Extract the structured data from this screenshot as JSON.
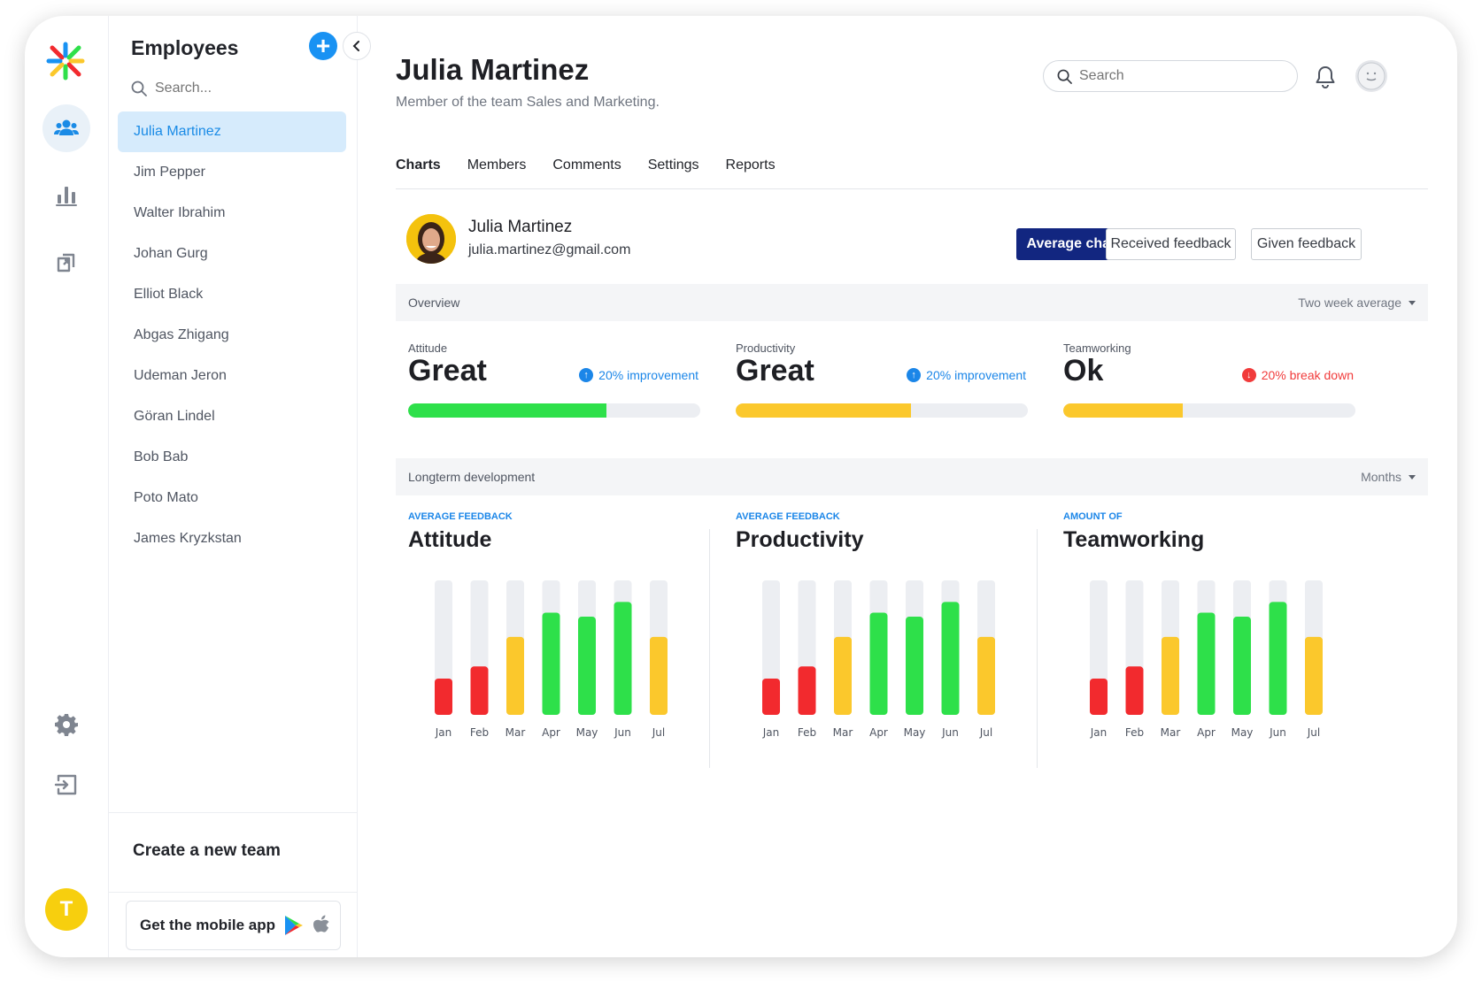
{
  "colors": {
    "accent": "#1992f3",
    "primary_button": "#122680",
    "green": "#2ee04a",
    "yellow": "#fbc82c",
    "red": "#f22a2e",
    "track": "#eceef2",
    "improvement": "#1b86e8",
    "breakdown": "#f13b3b"
  },
  "rail": {
    "items": [
      {
        "icon": "team-icon",
        "active": true
      },
      {
        "icon": "bar-chart-icon",
        "active": false
      },
      {
        "icon": "copy-icon",
        "active": false
      }
    ],
    "settings_icon": "gear-icon",
    "logout_icon": "logout-icon",
    "user_initial": "T"
  },
  "sidebar": {
    "title": "Employees",
    "search_placeholder": "Search...",
    "employees": [
      "Julia Martinez",
      "Jim Pepper",
      "Walter Ibrahim",
      "Johan Gurg",
      "Elliot Black",
      "Abgas Zhigang",
      "Udeman Jeron",
      "Göran Lindel",
      "Bob Bab",
      "Poto Mato",
      "James Kryzkstan"
    ],
    "active_index": 0,
    "create_team": "Create a new team",
    "mobile_app": "Get the mobile app"
  },
  "header": {
    "name": "Julia Martinez",
    "subtitle": "Member of the team Sales and Marketing.",
    "search_placeholder": "Search"
  },
  "tabs": [
    "Charts",
    "Members",
    "Comments",
    "Settings",
    "Reports"
  ],
  "profile": {
    "name": "Julia Martinez",
    "email": "julia.martinez@gmail.com"
  },
  "buttons": {
    "average": "Average charts",
    "received": "Received feedback",
    "given": "Given feedback"
  },
  "overview": {
    "label": "Overview",
    "range": "Two week average",
    "metrics": [
      {
        "label": "Attitude",
        "value": "Great",
        "delta": "20% improvement",
        "direction": "up",
        "level": 0.68,
        "color": "#2ee04a"
      },
      {
        "label": "Productivity",
        "value": "Great",
        "delta": "20% improvement",
        "direction": "up",
        "level": 0.6,
        "color": "#fbc82c"
      },
      {
        "label": "Teamworking",
        "value": "Ok",
        "delta": "20% break down",
        "direction": "down",
        "level": 0.41,
        "color": "#fbc82c"
      }
    ]
  },
  "longterm": {
    "label": "Longterm development",
    "range": "Months"
  },
  "chart_data": [
    {
      "type": "bar",
      "subtitle": "AVERAGE FEEDBACK",
      "title": "Attitude",
      "categories": [
        "Jan",
        "Feb",
        "Mar",
        "Apr",
        "May",
        "Jun",
        "Jul"
      ],
      "values": [
        27,
        36,
        58,
        76,
        73,
        84,
        58
      ],
      "ylim": [
        0,
        100
      ]
    },
    {
      "type": "bar",
      "subtitle": "AVERAGE FEEDBACK",
      "title": "Productivity",
      "categories": [
        "Jan",
        "Feb",
        "Mar",
        "Apr",
        "May",
        "Jun",
        "Jul"
      ],
      "values": [
        27,
        36,
        58,
        76,
        73,
        84,
        58
      ],
      "ylim": [
        0,
        100
      ]
    },
    {
      "type": "bar",
      "subtitle": "AMOUNT OF",
      "title": "Teamworking",
      "categories": [
        "Jan",
        "Feb",
        "Mar",
        "Apr",
        "May",
        "Jun",
        "Jul"
      ],
      "values": [
        27,
        36,
        58,
        76,
        73,
        84,
        58
      ],
      "ylim": [
        0,
        100
      ]
    }
  ]
}
